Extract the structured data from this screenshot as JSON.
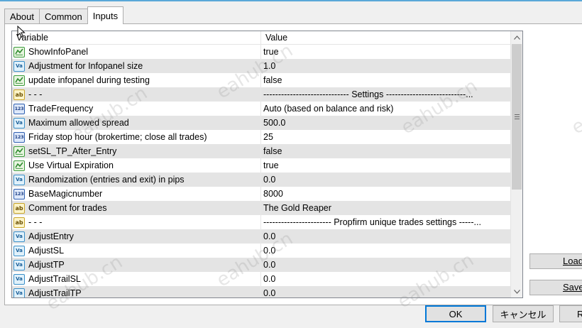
{
  "tabs": [
    {
      "label": "About",
      "active": false
    },
    {
      "label": "Common",
      "active": false
    },
    {
      "label": "Inputs",
      "active": true
    }
  ],
  "table": {
    "headers": {
      "variable": "Variable",
      "value": "Value"
    },
    "rows": [
      {
        "type": "bool",
        "icon_text": "",
        "name": "ShowInfoPanel",
        "value": "true"
      },
      {
        "type": "dbl",
        "icon_text": "Va",
        "name": "Adjustment for Infopanel size",
        "value": "1.0"
      },
      {
        "type": "bool",
        "icon_text": "",
        "name": "update infopanel during testing",
        "value": "false"
      },
      {
        "type": "str",
        "icon_text": "ab",
        "name": "- - -",
        "value": "----------------------------- Settings ---------------------------..."
      },
      {
        "type": "int",
        "icon_text": "123",
        "name": "TradeFrequency",
        "value": "Auto (based on balance and risk)"
      },
      {
        "type": "dbl",
        "icon_text": "Va",
        "name": "Maximum allowed spread",
        "value": "500.0"
      },
      {
        "type": "int",
        "icon_text": "123",
        "name": "Friday stop hour (brokertime; close all trades)",
        "value": "25"
      },
      {
        "type": "bool",
        "icon_text": "",
        "name": "setSL_TP_After_Entry",
        "value": "false"
      },
      {
        "type": "bool",
        "icon_text": "",
        "name": "Use Virtual Expiration",
        "value": "true"
      },
      {
        "type": "dbl",
        "icon_text": "Va",
        "name": "Randomization (entries and exit) in pips",
        "value": "0.0"
      },
      {
        "type": "int",
        "icon_text": "123",
        "name": "BaseMagicnumber",
        "value": "8000"
      },
      {
        "type": "str",
        "icon_text": "ab",
        "name": "Comment for trades",
        "value": "The Gold Reaper"
      },
      {
        "type": "str",
        "icon_text": "ab",
        "name": "- - -",
        "value": "----------------------- Propfirm unique trades settings -----..."
      },
      {
        "type": "dbl",
        "icon_text": "Va",
        "name": "AdjustEntry",
        "value": "0.0"
      },
      {
        "type": "dbl",
        "icon_text": "Va",
        "name": "AdjustSL",
        "value": "0.0"
      },
      {
        "type": "dbl",
        "icon_text": "Va",
        "name": "AdjustTP",
        "value": "0.0"
      },
      {
        "type": "dbl",
        "icon_text": "Va",
        "name": "AdjustTrailSL",
        "value": "0.0"
      },
      {
        "type": "dbl",
        "icon_text": "Va",
        "name": "AdjustTrailTP",
        "value": "0.0"
      }
    ]
  },
  "buttons": {
    "load": "Load",
    "save": "Save",
    "ok": "OK",
    "cancel": "キャンセル",
    "reset": "R"
  },
  "watermarks": [
    "eahub.cn",
    "eahub.cn",
    "eahub.cn",
    "eahub.cn",
    "eahub.cn",
    "eahub.cn",
    "eahub.cn"
  ],
  "colors": {
    "accent": "#0078d7",
    "row_alt": "#e4e4e4",
    "top_bar": "#5aa8d8"
  }
}
